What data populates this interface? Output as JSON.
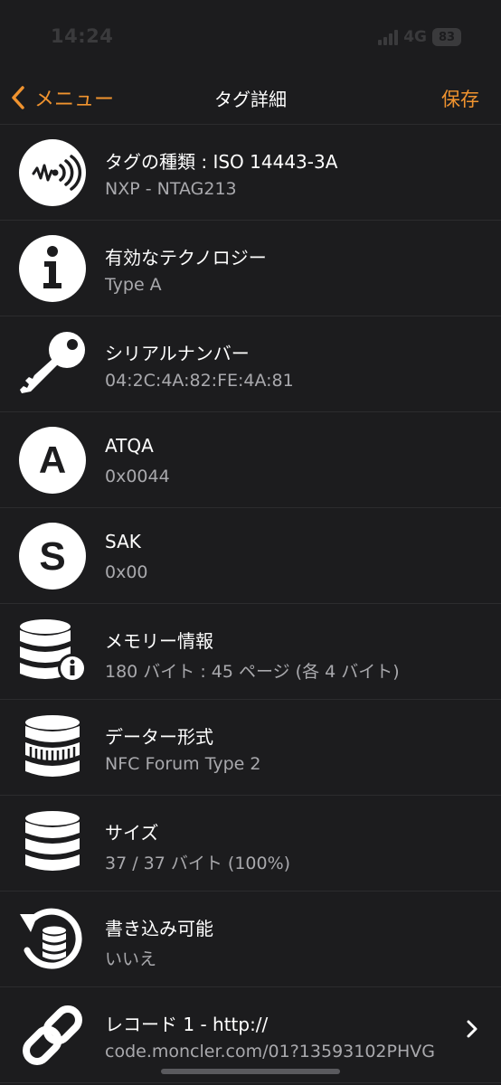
{
  "status_bar": {
    "time": "14:24",
    "network": "4G",
    "battery": "83",
    "color": "#3a3a3c"
  },
  "nav": {
    "back_label": "メニュー",
    "title": "タグ詳細",
    "save_label": "保存",
    "accent_color": "#f0932f"
  },
  "rows": [
    {
      "icon": "nfc-signal-icon",
      "title": "タグの種類 : ISO 14443-3A",
      "value": "NXP - NTAG213"
    },
    {
      "icon": "info-icon",
      "title": "有効なテクノロジー",
      "value": "Type A"
    },
    {
      "icon": "key-icon",
      "title": "シリアルナンバー",
      "value": "04:2C:4A:82:FE:4A:81"
    },
    {
      "icon": "letter-a-icon",
      "title": "ATQA",
      "value": "0x0044"
    },
    {
      "icon": "letter-s-icon",
      "title": "SAK",
      "value": "0x00"
    },
    {
      "icon": "database-info-icon",
      "title": "メモリー情報",
      "value": "180 バイト : 45 ページ (各 4 バイト)"
    },
    {
      "icon": "database-format-icon",
      "title": "データー形式",
      "value": "NFC Forum Type 2"
    },
    {
      "icon": "database-icon",
      "title": "サイズ",
      "value": "37 / 37 バイト (100%)"
    },
    {
      "icon": "database-rewrite-icon",
      "title": "書き込み可能",
      "value": "いいえ"
    },
    {
      "icon": "link-icon",
      "title": "レコード 1 - http://",
      "value": "code.moncler.com/01?13593102PHVG"
    }
  ]
}
